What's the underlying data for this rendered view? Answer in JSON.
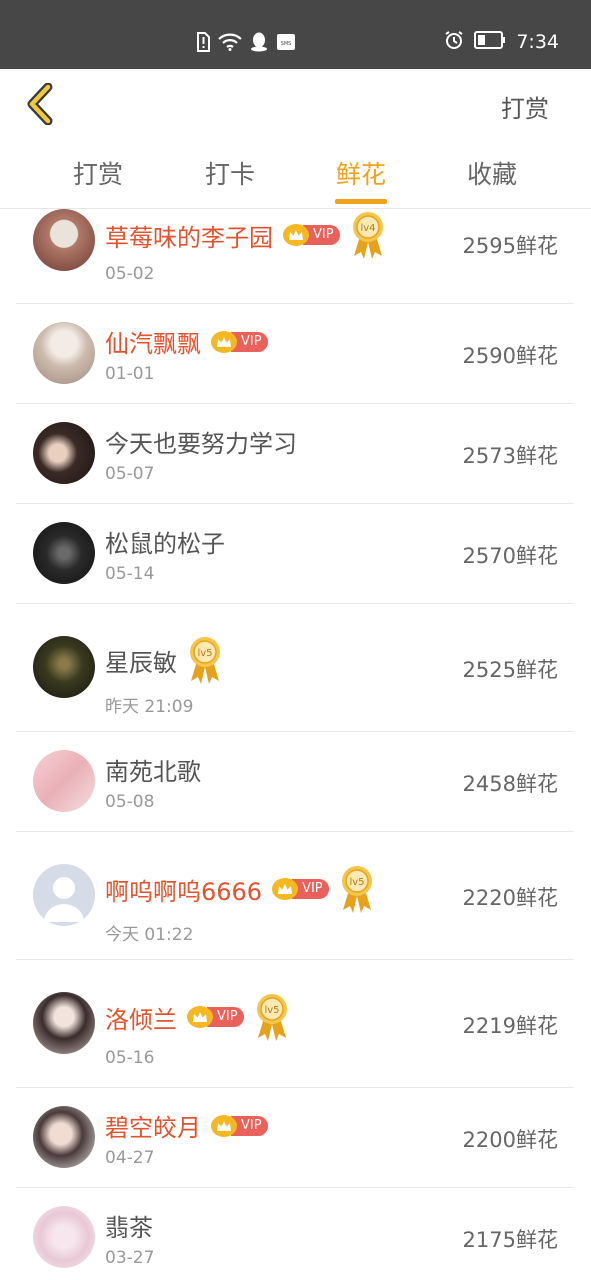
{
  "status_bar": {
    "time": "7:34",
    "sms_label": "SMS",
    "icons": [
      "sim-alert-icon",
      "wifi-icon",
      "qq-icon",
      "sms-icon",
      "alarm-icon",
      "battery-icon"
    ]
  },
  "header": {
    "back_icon": "chevron-left-icon",
    "action_label": "打赏"
  },
  "tabs": [
    {
      "label": "打赏",
      "active": false
    },
    {
      "label": "打卡",
      "active": false
    },
    {
      "label": "鲜花",
      "active": true
    },
    {
      "label": "收藏",
      "active": false
    }
  ],
  "colors": {
    "accent": "#f0a21c",
    "vip_name": "#e2532f",
    "vip_tag": "#e8615a",
    "status_bar": "#474747"
  },
  "list": [
    {
      "name": "草莓味的李子园",
      "vip": true,
      "level": "lv4",
      "date": "05-02",
      "amount": "2595鲜花"
    },
    {
      "name": "仙汽飘飘",
      "vip": true,
      "level": "",
      "date": "01-01",
      "amount": "2590鲜花"
    },
    {
      "name": "今天也要努力学习",
      "vip": false,
      "level": "",
      "date": "05-07",
      "amount": "2573鲜花"
    },
    {
      "name": "松鼠的松子",
      "vip": false,
      "level": "",
      "date": "05-14",
      "amount": "2570鲜花"
    },
    {
      "name": "星辰敏",
      "vip": false,
      "level": "lv5",
      "date": "昨天 21:09",
      "amount": "2525鲜花"
    },
    {
      "name": "南苑北歌",
      "vip": false,
      "level": "",
      "date": "05-08",
      "amount": "2458鲜花"
    },
    {
      "name": "啊呜啊呜6666",
      "vip": true,
      "level": "lv5",
      "date": "今天 01:22",
      "amount": "2220鲜花"
    },
    {
      "name": "洛倾兰",
      "vip": true,
      "level": "lv5",
      "date": "05-16",
      "amount": "2219鲜花"
    },
    {
      "name": "碧空皎月",
      "vip": true,
      "level": "",
      "date": "04-27",
      "amount": "2200鲜花"
    },
    {
      "name": "翡茶",
      "vip": false,
      "level": "",
      "date": "03-27",
      "amount": "2175鲜花"
    }
  ],
  "vip_label": "VIP"
}
